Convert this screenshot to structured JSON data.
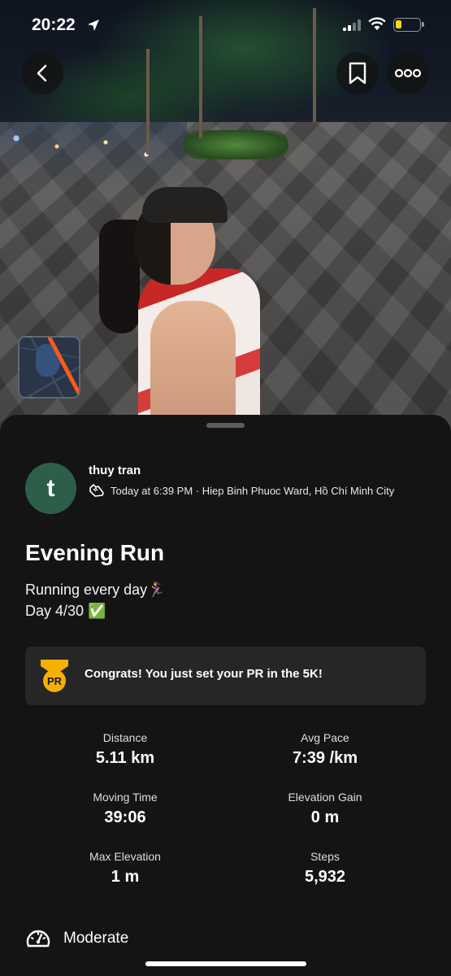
{
  "status_bar": {
    "time": "20:22",
    "icons": [
      "location-arrow-icon",
      "signal-icon",
      "wifi-icon",
      "battery-icon"
    ],
    "battery_color": "#ffd60a"
  },
  "header": {
    "back_icon": "chevron-left-icon",
    "bookmark_icon": "bookmark-icon",
    "more_icon": "more-dots-icon"
  },
  "map_thumbnail": {
    "route_color": "#fc5a1b"
  },
  "athlete": {
    "initial": "t",
    "name": "thuy tran",
    "avatar_color": "#2d5e4a",
    "meta": "Today at 6:39 PM · Hiep Binh Phuoc Ward, Hồ Chí Minh City",
    "activity_icon": "running-shoe-icon"
  },
  "activity": {
    "title": "Evening Run",
    "description_line1": "Running every day🏃‍♀️",
    "description_line2": "Day 4/30 ✅"
  },
  "pr_banner": {
    "medal_text": "PR",
    "message": "Congrats! You just set your PR in the 5K!",
    "medal_color": "#f5b000"
  },
  "stats": [
    {
      "label": "Distance",
      "value": "5.11 km"
    },
    {
      "label": "Avg Pace",
      "value": "7:39 /km"
    },
    {
      "label": "Moving Time",
      "value": "39:06"
    },
    {
      "label": "Elevation Gain",
      "value": "0 m"
    },
    {
      "label": "Max Elevation",
      "value": "1 m"
    },
    {
      "label": "Steps",
      "value": "5,932"
    }
  ],
  "effort": {
    "icon": "gauge-icon",
    "label": "Moderate"
  }
}
